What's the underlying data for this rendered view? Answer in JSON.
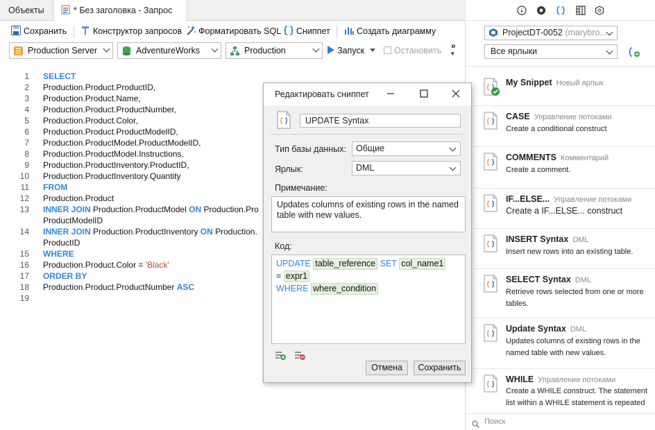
{
  "tabs": {
    "objects": "Объекты",
    "query": "* Без заголовка - Запрос"
  },
  "toolbar": {
    "save": "Сохранить",
    "query_builder": "Конструктор запросов",
    "format_sql": "Форматировать SQL",
    "snippet": "Сниппет",
    "create_chart": "Создать диаграмму"
  },
  "connection": {
    "server": "Production Server",
    "database": "AdventureWorks",
    "schema": "Production",
    "run": "Запуск",
    "stop": "Остановить"
  },
  "editor": {
    "lines": [
      {
        "n": "1",
        "html": "<span class=\"kw\">SELECT</span>"
      },
      {
        "n": "2",
        "html": "Production.Product.ProductID,"
      },
      {
        "n": "3",
        "html": "Production.Product.Name,"
      },
      {
        "n": "4",
        "html": "Production.Product.ProductNumber,"
      },
      {
        "n": "5",
        "html": "Production.Product.Color,"
      },
      {
        "n": "6",
        "html": "Production.Product.ProductModelID,"
      },
      {
        "n": "7",
        "html": "Production.ProductModel.ProductModelID,"
      },
      {
        "n": "8",
        "html": "Production.ProductModel.Instructions,"
      },
      {
        "n": "9",
        "html": "Production.ProductInventory.ProductID,"
      },
      {
        "n": "10",
        "html": "Production.ProductInventory.Quantity"
      },
      {
        "n": "11",
        "html": "<span class=\"kw\">FROM</span>"
      },
      {
        "n": "12",
        "html": "Production.Product"
      },
      {
        "n": "13",
        "html": "<span class=\"kw\">INNER JOIN</span> Production.ProductModel <span class=\"kw\">ON</span> Production.Pro"
      },
      {
        "n": "",
        "html": "ProductModelID"
      },
      {
        "n": "14",
        "html": "<span class=\"kw\">INNER JOIN</span> Production.ProductInventory <span class=\"kw\">ON</span> Production."
      },
      {
        "n": "",
        "html": "ProductID"
      },
      {
        "n": "15",
        "html": "<span class=\"kw\">WHERE</span>"
      },
      {
        "n": "16",
        "html": "Production.Product.Color = <span class=\"str\">'Black'</span>"
      },
      {
        "n": "17",
        "html": "<span class=\"kw\">ORDER BY</span>"
      },
      {
        "n": "18",
        "html": "Production.Product.ProductNumber <span class=\"kw\">ASC</span>"
      },
      {
        "n": "19",
        "html": ""
      }
    ]
  },
  "dialog": {
    "title": "Редактировать сниппет",
    "name": "UPDATE Syntax",
    "db_type_label": "Тип базы данных:",
    "db_type_value": "Общие",
    "label_label": "Ярлык:",
    "label_value": "DML",
    "note_label": "Примечание:",
    "note": "Updates columns of existing rows in the named table with new values.",
    "code_label": "Код:",
    "code": {
      "kw_update": "UPDATE",
      "ph_table": "table_reference",
      "kw_set": "SET",
      "ph_col": "col_name1",
      "eq": "=",
      "ph_expr": "expr1",
      "kw_where": "WHERE",
      "ph_where": "where_condition"
    },
    "cancel": "Отмена",
    "save": "Сохранить"
  },
  "right": {
    "project": "ProjectDT-0052",
    "project_user": "(marybro...",
    "filter": "Все ярлыки",
    "search_placeholder": "Поиск",
    "snippets": [
      {
        "name": "My Snippet",
        "tag": "Новый ярлык",
        "desc": ""
      },
      {
        "name": "CASE",
        "tag": "Управление потоками",
        "desc": "Create a conditional construct"
      },
      {
        "name": "COMMENTS",
        "tag": "Комментарий",
        "desc": "Create a comment."
      },
      {
        "name": "IF...ELSE...",
        "tag": "Управление потоками",
        "desc": "Create a IF...ELSE... construct"
      },
      {
        "name": "INSERT Syntax",
        "tag": "DML",
        "desc": "Insert new rows into an existing table."
      },
      {
        "name": "SELECT Syntax",
        "tag": "DML",
        "desc": "Retrieve rows selected from one or more tables."
      },
      {
        "name": "Update Syntax",
        "tag": "DML",
        "desc": "Updates columns of existing rows in the named table with new values."
      },
      {
        "name": "WHILE",
        "tag": "Управление потоками",
        "desc": "Create a WHILE construct. The statement list within a WHILE statement is repeated"
      }
    ]
  },
  "colors": {
    "keyword": "#2e86de",
    "string": "#b5473a",
    "placeholder_bg": "#e3f0dc",
    "snippet_icon": "#2b7cd3",
    "snippet_accent": "#f0a23a"
  }
}
